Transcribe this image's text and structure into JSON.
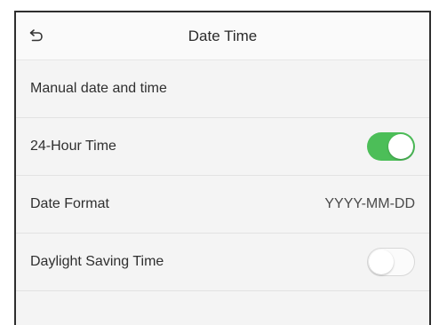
{
  "header": {
    "title": "Date Time",
    "back_icon": "back-arrow-icon"
  },
  "settings": [
    {
      "label": "Manual date and time"
    },
    {
      "label": "24-Hour Time",
      "toggle": true,
      "state": "on"
    },
    {
      "label": "Date Format",
      "value": "YYYY-MM-DD"
    },
    {
      "label": "Daylight Saving Time",
      "toggle": true,
      "state": "off"
    }
  ],
  "colors": {
    "toggle_on": "#4cbe58",
    "background": "#f4f4f4",
    "frame": "#2e2e2e"
  }
}
